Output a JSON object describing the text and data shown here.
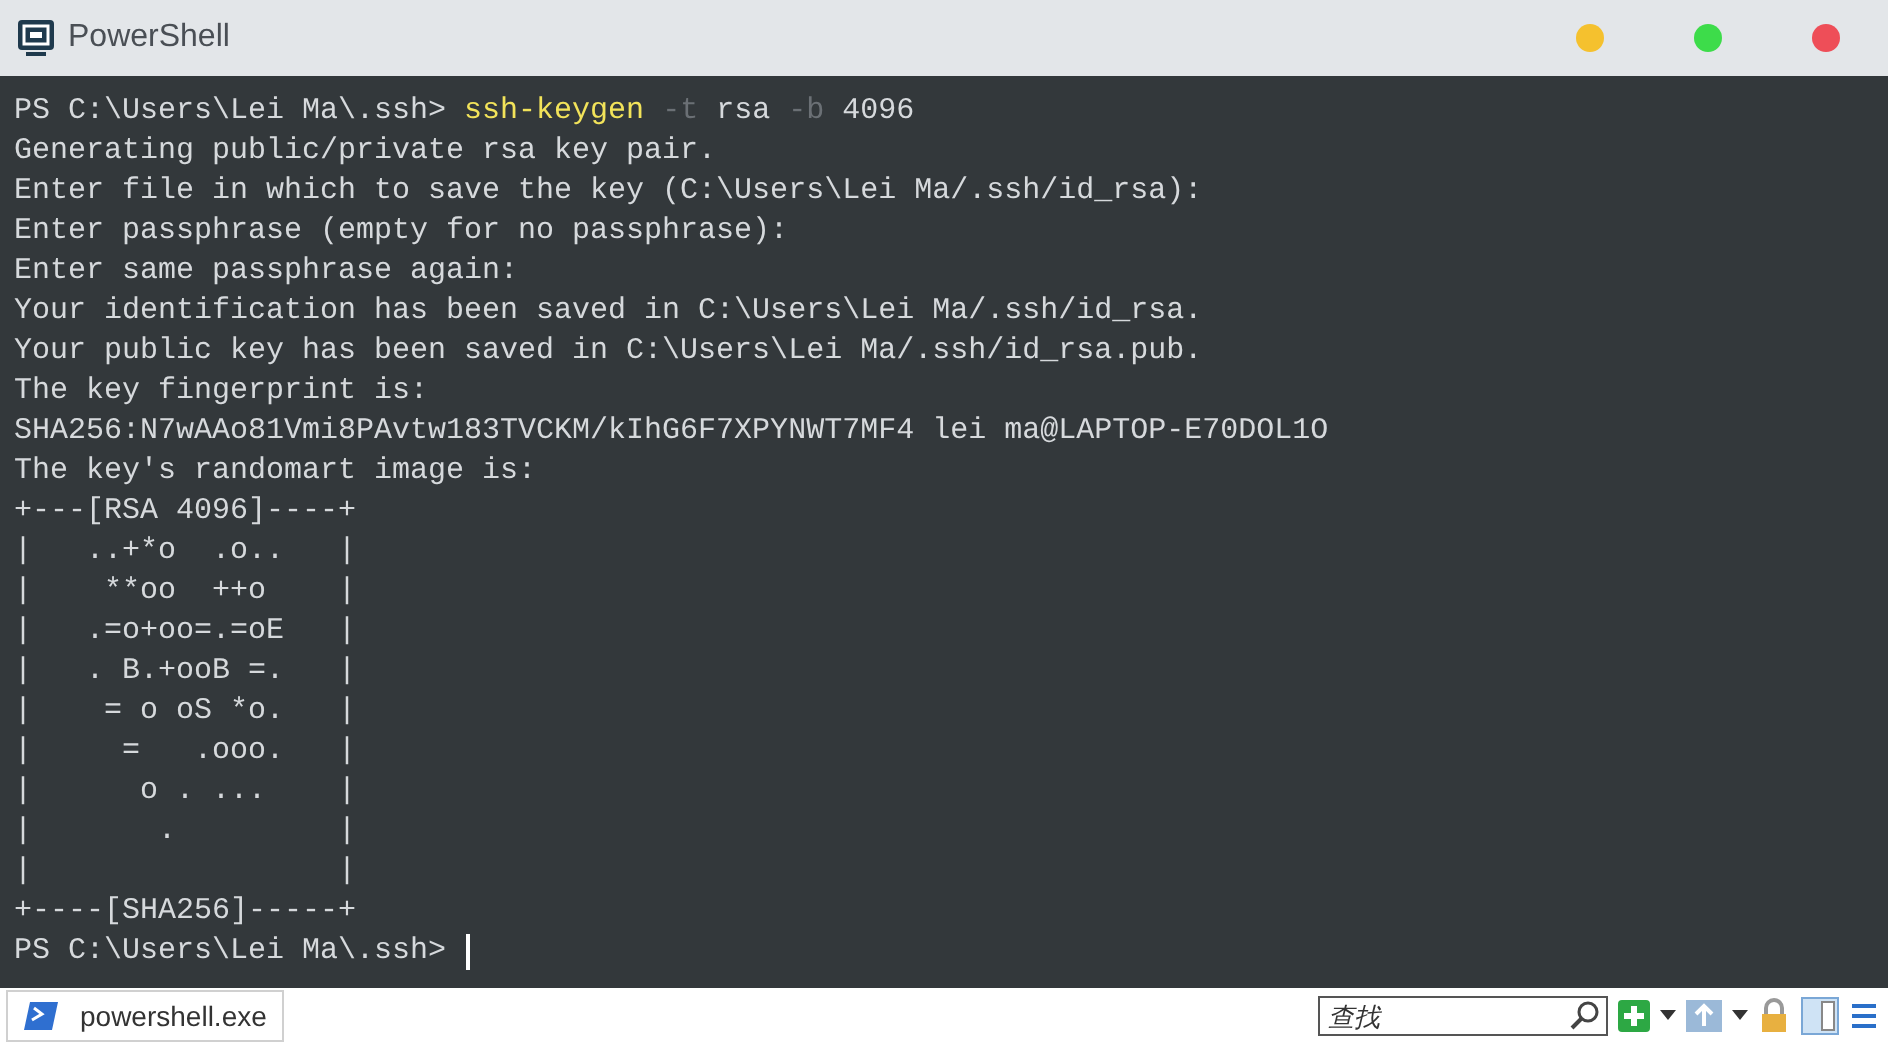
{
  "window": {
    "title": "PowerShell"
  },
  "title_buttons": [
    {
      "color": "#f5c12e"
    },
    {
      "color": "#3ddc4a"
    },
    {
      "color": "#ee4e58"
    }
  ],
  "terminal": {
    "lines": [
      [
        {
          "kind": "prompt",
          "text": "PS C:\\Users\\Lei Ma\\.ssh> "
        },
        {
          "kind": "command",
          "text": "ssh-keygen"
        },
        {
          "kind": "param",
          "text": " -t"
        },
        {
          "kind": "plain",
          "text": " rsa"
        },
        {
          "kind": "param",
          "text": " -b"
        },
        {
          "kind": "plain",
          "text": " 4096"
        }
      ],
      [
        {
          "kind": "plain",
          "text": "Generating public/private rsa key pair."
        }
      ],
      [
        {
          "kind": "plain",
          "text": "Enter file in which to save the key (C:\\Users\\Lei Ma/.ssh/id_rsa):"
        }
      ],
      [
        {
          "kind": "plain",
          "text": "Enter passphrase (empty for no passphrase):"
        }
      ],
      [
        {
          "kind": "plain",
          "text": "Enter same passphrase again:"
        }
      ],
      [
        {
          "kind": "plain",
          "text": "Your identification has been saved in C:\\Users\\Lei Ma/.ssh/id_rsa."
        }
      ],
      [
        {
          "kind": "plain",
          "text": "Your public key has been saved in C:\\Users\\Lei Ma/.ssh/id_rsa.pub."
        }
      ],
      [
        {
          "kind": "plain",
          "text": "The key fingerprint is:"
        }
      ],
      [
        {
          "kind": "plain",
          "text": "SHA256:N7wAAo81Vmi8PAvtw183TVCKM/kIhG6F7XPYNWT7MF4 lei ma@LAPTOP-E70DOL1O"
        }
      ],
      [
        {
          "kind": "plain",
          "text": "The key's randomart image is:"
        }
      ],
      [
        {
          "kind": "plain",
          "text": "+---[RSA 4096]----+"
        }
      ],
      [
        {
          "kind": "plain",
          "text": "|   ..+*o  .o..   |"
        }
      ],
      [
        {
          "kind": "plain",
          "text": "|    **oo  ++o    |"
        }
      ],
      [
        {
          "kind": "plain",
          "text": "|   .=o+oo=.=oE   |"
        }
      ],
      [
        {
          "kind": "plain",
          "text": "|   . B.+ooB =.   |"
        }
      ],
      [
        {
          "kind": "plain",
          "text": "|    = o oS *o.   |"
        }
      ],
      [
        {
          "kind": "plain",
          "text": "|     =   .ooo.   |"
        }
      ],
      [
        {
          "kind": "plain",
          "text": "|      o . ...    |"
        }
      ],
      [
        {
          "kind": "plain",
          "text": "|       .         |"
        }
      ],
      [
        {
          "kind": "plain",
          "text": "|                 |"
        }
      ],
      [
        {
          "kind": "plain",
          "text": "+----[SHA256]-----+"
        }
      ],
      [
        {
          "kind": "prompt",
          "text": "PS C:\\Users\\Lei Ma\\.ssh> "
        },
        {
          "kind": "cursor"
        }
      ]
    ]
  },
  "taskbar": {
    "task": "powershell.exe",
    "search_placeholder": "查找"
  }
}
